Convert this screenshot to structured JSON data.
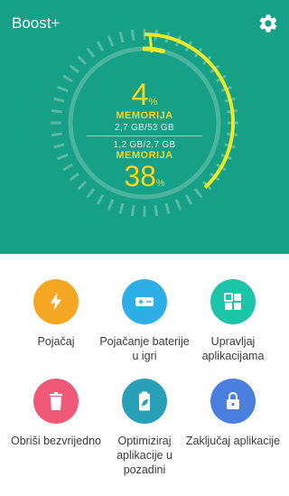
{
  "app": {
    "title": "Boost+"
  },
  "storage": {
    "percent": "4",
    "percent_unit": "%",
    "label": "MEMORIJA",
    "detail": "2,7 GB/53 GB",
    "level": 0.04
  },
  "ram": {
    "percent": "38",
    "percent_unit": "%",
    "label": "MEMORIJA",
    "detail": "1,2 GB/2,7 GB",
    "level": 0.38
  },
  "actions": [
    {
      "label": "Pojačaj",
      "color": "#f5a623",
      "icon": "lightning-icon"
    },
    {
      "label": "Pojačanje baterije u igri",
      "color": "#2eaee6",
      "icon": "gamepad-icon"
    },
    {
      "label": "Upravljaj aplikacijama",
      "color": "#1cc4a8",
      "icon": "apps-grid-icon"
    },
    {
      "label": "Obriši bezvrijedno",
      "color": "#f05a78",
      "icon": "trash-icon"
    },
    {
      "label": "Optimiziraj aplikacije u pozadini",
      "color": "#27a0b8",
      "icon": "battery-leaf-icon"
    },
    {
      "label": "Zaključaj aplikacije",
      "color": "#4a7fe0",
      "icon": "lock-icon"
    }
  ],
  "colors": {
    "header_bg": "#16a086",
    "accent_yellow": "#e8ea2a",
    "text_yellow": "#ffd21f"
  }
}
